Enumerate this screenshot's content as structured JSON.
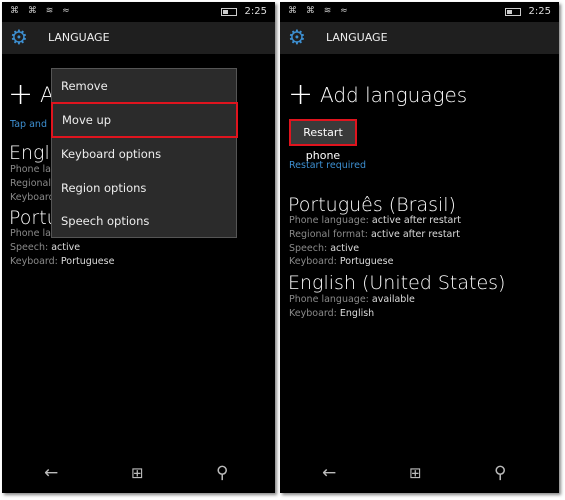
{
  "status": {
    "time": "2:25",
    "icons": "⌘ ⌘ ≋ ≈"
  },
  "header": {
    "title": "LANGUAGE"
  },
  "left": {
    "add_fragment": "A",
    "hint_fragment": "Tap and",
    "lang1_fragment": "Englis",
    "lang1_lines": [
      "Phone lan",
      "Regional",
      "Keyboard"
    ],
    "lang2_fragment": "Portu",
    "lang2_line1": "Phone lang",
    "lang2_speech_label": "Speech:",
    "lang2_speech_value": "active",
    "lang2_keyboard_label": "Keyboard:",
    "lang2_keyboard_value": "Portuguese",
    "menu": [
      "Remove",
      "Move up",
      "Keyboard options",
      "Region options",
      "Speech options"
    ],
    "highlighted_item": "Move up"
  },
  "right": {
    "add_label": "Add languages",
    "restart_button": "Restart phone",
    "restart_required": "Restart required",
    "languages": [
      {
        "name": "Português (Brasil)",
        "lines": [
          {
            "label": "Phone language:",
            "value": "active after restart"
          },
          {
            "label": "Regional format:",
            "value": "active after restart"
          },
          {
            "label": "Speech:",
            "value": "active"
          },
          {
            "label": "Keyboard:",
            "value": "Portuguese"
          }
        ]
      },
      {
        "name": "English (United States)",
        "lines": [
          {
            "label": "Phone language:",
            "value": "available"
          },
          {
            "label": "Keyboard:",
            "value": "English"
          }
        ]
      }
    ]
  },
  "colors": {
    "accent": "#3d8fd1",
    "highlight": "#e0141e",
    "menu_bg": "#2b2b2b"
  },
  "nav_icons": [
    "back-arrow-icon",
    "windows-start-icon",
    "search-icon"
  ]
}
